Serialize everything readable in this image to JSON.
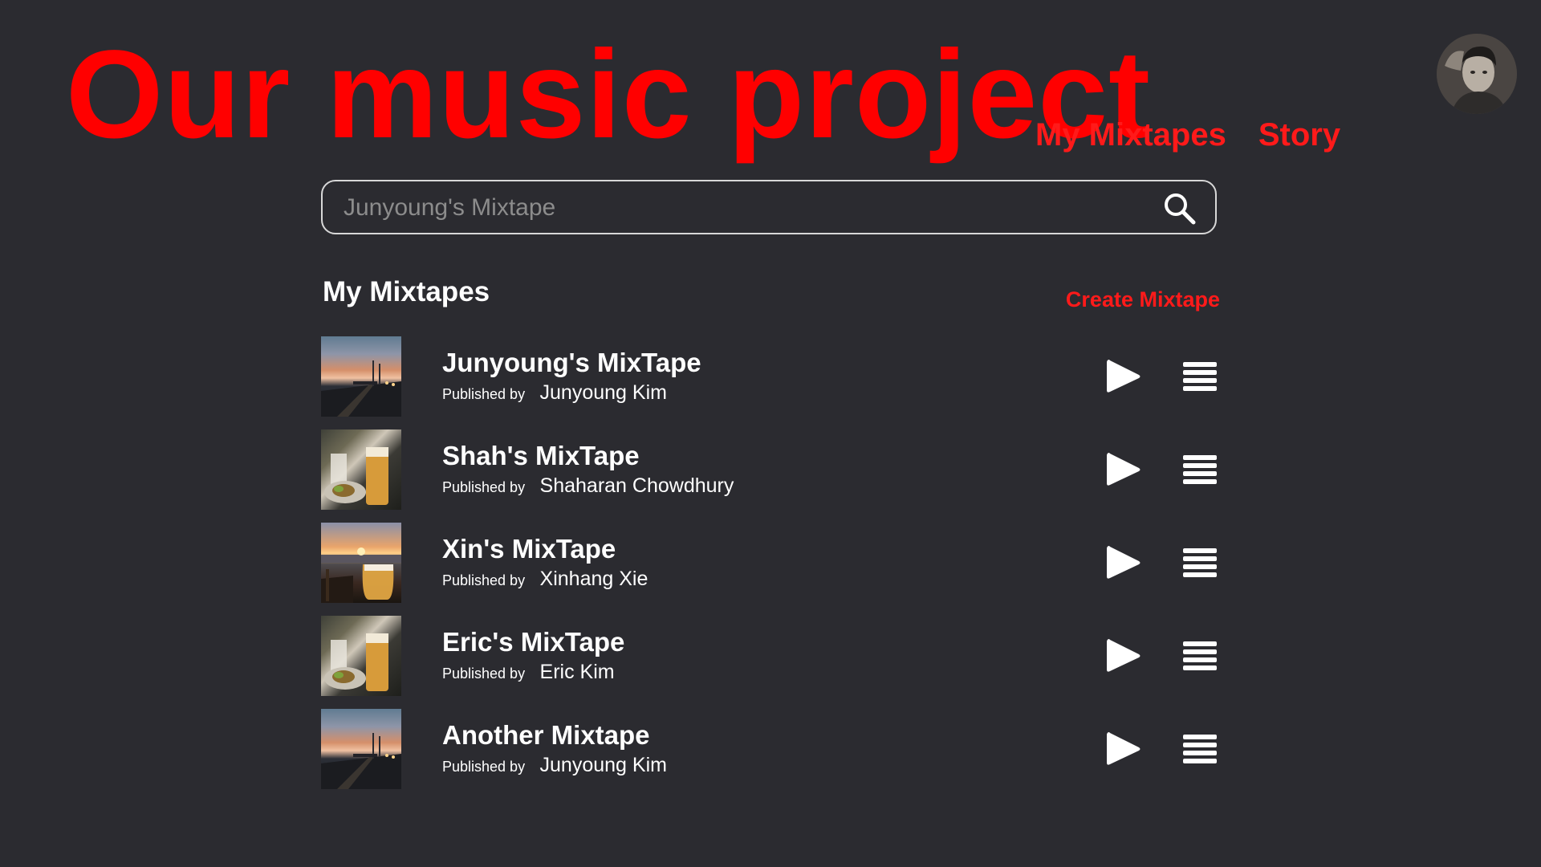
{
  "header": {
    "app_title": "Our music project",
    "nav": [
      {
        "label": "My Mixtapes"
      },
      {
        "label": "Story"
      }
    ],
    "avatar_icon": "user-avatar"
  },
  "search": {
    "value": "",
    "placeholder": "Junyoung's Mixtape",
    "icon": "search-icon"
  },
  "section": {
    "title": "My Mixtapes",
    "create_label": "Create Mixtape"
  },
  "byline_label": "Published by",
  "mixtapes": [
    {
      "title": "Junyoung's MixTape",
      "author": "Junyoung Kim",
      "thumbnail": "sunset-pier"
    },
    {
      "title": "Shah's MixTape",
      "author": "Shaharan Chowdhury",
      "thumbnail": "drinks-table"
    },
    {
      "title": "Xin's MixTape",
      "author": "Xinhang Xie",
      "thumbnail": "harbor-beer"
    },
    {
      "title": "Eric's MixTape",
      "author": "Eric Kim",
      "thumbnail": "drinks-table"
    },
    {
      "title": "Another Mixtape",
      "author": "Junyoung Kim",
      "thumbnail": "sunset-pier"
    }
  ],
  "colors": {
    "background": "#2b2b30",
    "accent": "#ff0000",
    "text": "#ffffff"
  }
}
